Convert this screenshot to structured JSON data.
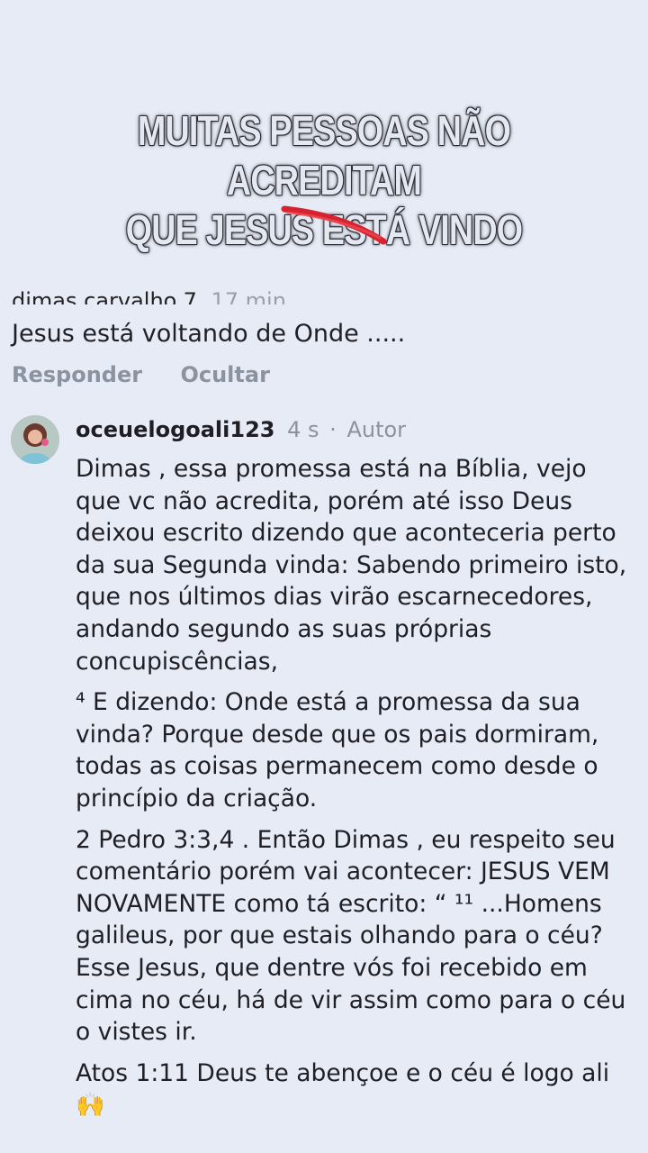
{
  "overlay": {
    "line1": "MUITAS PESSOAS NÃO ACREDITAM",
    "line2": "QUE JESUS ESTÁ VINDO"
  },
  "previous_comment": {
    "username_partial": "dimas.carvalho.7",
    "time_partial": "17 min",
    "text": "Jesus está voltando de Onde .....",
    "actions": [
      "Responder",
      "Ocultar"
    ]
  },
  "reply": {
    "username": "oceuelogoali123",
    "time": "4 s",
    "separator": "·",
    "role": "Autor",
    "paragraphs": [
      "Dimas , essa promessa está na Bíblia, vejo que vc não acredita, porém até isso Deus deixou escrito dizendo que aconteceria perto da sua Segunda vinda: Sabendo primeiro isto, que nos últimos dias virão escarnecedores, andando segundo as suas próprias concupiscências,",
      "⁴ E dizendo: Onde está a promessa da sua vinda? Porque desde que os pais dormiram, todas as coisas permanecem como desde o princípio da criação.",
      "2 Pedro 3:3,4 . Então Dimas , eu respeito seu comentário porém vai acontecer: JESUS VEM NOVAMENTE como tá escrito: “ ¹¹ ...Homens galileus, por que estais olhando para o céu? Esse Jesus, que dentre vós foi recebido em cima no céu, há de vir assim como para o céu o vistes ir.",
      "Atos 1:11 Deus te abençoe e o céu é logo ali"
    ],
    "emoji": "🙌"
  },
  "colors": {
    "background": "#e6ebf5",
    "accent_red": "#d8232f",
    "muted": "#8c93a0"
  }
}
